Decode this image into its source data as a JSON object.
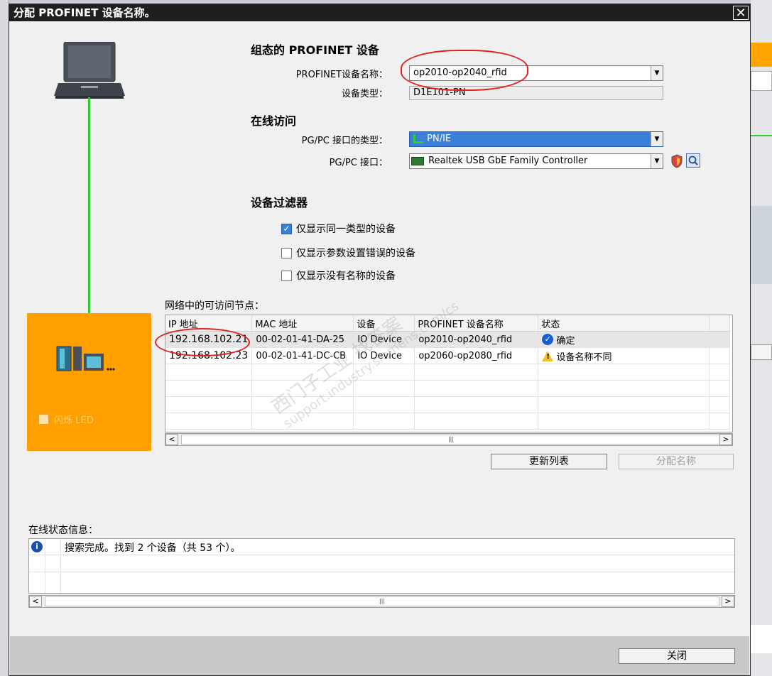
{
  "dialog": {
    "title": "分配 PROFINET 设备名称。",
    "close_glyph": "✕"
  },
  "configured": {
    "heading": "组态的 PROFINET 设备",
    "name_label": "PROFINET设备名称：",
    "name_value": "op2010-op2040_rfid",
    "type_label": "设备类型：",
    "type_value": "D1E101-PN"
  },
  "online": {
    "heading": "在线访问",
    "iftype_label": "PG/PC 接口的类型：",
    "iftype_value": "PN/IE",
    "if_label": "PG/PC 接口：",
    "if_value": "Realtek USB GbE Family Controller"
  },
  "filter": {
    "heading": "设备过滤器",
    "options": [
      {
        "label": "仅显示同一类型的设备",
        "checked": true
      },
      {
        "label": "仅显示参数设置错误的设备",
        "checked": false
      },
      {
        "label": "仅显示没有名称的设备",
        "checked": false
      }
    ]
  },
  "nodes": {
    "title": "网络中的可访问节点：",
    "columns": [
      "IP 地址",
      "MAC 地址",
      "设备",
      "PROFINET 设备名称",
      "状态"
    ],
    "rows": [
      {
        "ip": "192.168.102.21",
        "mac": "00-02-01-41-DA-25",
        "device": "IO Device",
        "name": "op2010-op2040_rfid",
        "status": "确定",
        "status_icon": "check-circle-icon"
      },
      {
        "ip": "192.168.102.23",
        "mac": "00-02-01-41-DC-CB",
        "device": "IO Device",
        "name": "op2060-op2080_rfid",
        "status": "设备名称不同",
        "status_icon": "warning-icon"
      }
    ],
    "update_btn": "更新列表",
    "assign_btn": "分配名称"
  },
  "led": {
    "label": "闪烁 LED"
  },
  "status_info": {
    "title": "在线状态信息：",
    "message": "搜索完成。找到 2 个设备（共 53 个）。"
  },
  "footer": {
    "close_btn": "关闭"
  },
  "watermark": {
    "line1": "西门子工业 找答案",
    "line2": "support.industry.siemens.com/cs"
  },
  "colors": {
    "accent_orange": "#ff9f00",
    "link_green": "#33cc33",
    "select_blue": "#3a7fd8",
    "annotation_red": "#e02020"
  }
}
